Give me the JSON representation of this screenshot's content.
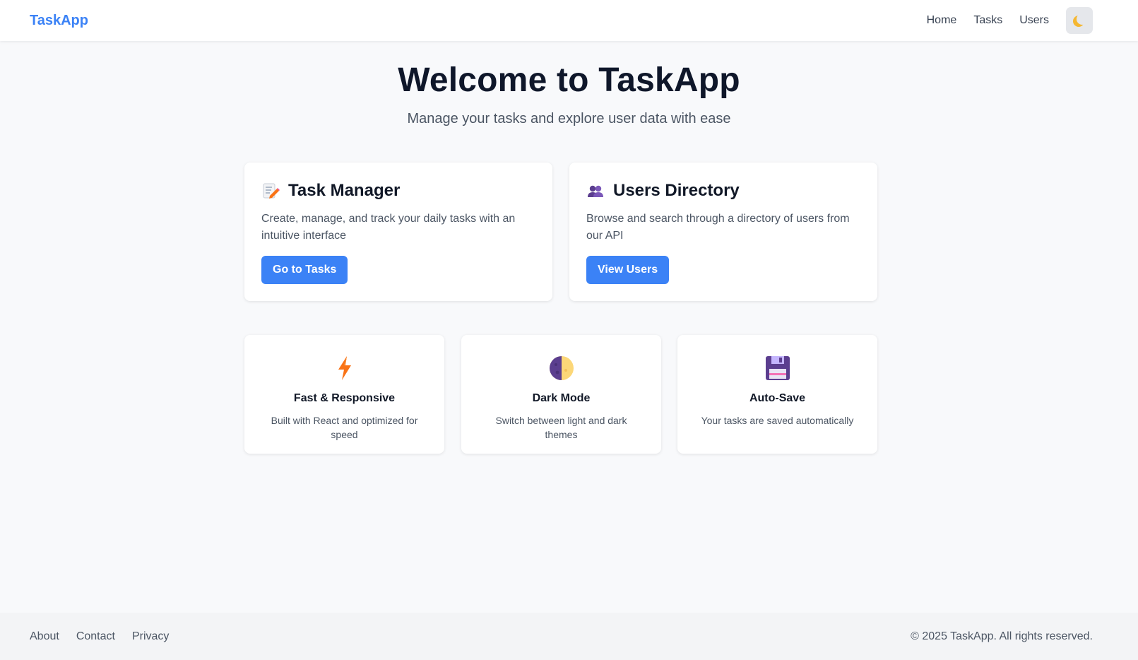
{
  "navbar": {
    "brand": "TaskApp",
    "links": [
      "Home",
      "Tasks",
      "Users"
    ],
    "theme_toggle_icon": "moon-icon"
  },
  "hero": {
    "title": "Welcome to TaskApp",
    "subtitle": "Manage your tasks and explore user data with ease"
  },
  "cards": [
    {
      "icon": "memo-icon",
      "title": "Task Manager",
      "description": "Create, manage, and track your daily tasks with an intuitive interface",
      "button": "Go to Tasks"
    },
    {
      "icon": "users-icon",
      "title": "Users Directory",
      "description": "Browse and search through a directory of users from our API",
      "button": "View Users"
    }
  ],
  "features": [
    {
      "icon": "lightning-icon",
      "title": "Fast & Responsive",
      "description": "Built with React and optimized for speed"
    },
    {
      "icon": "half-moon-icon",
      "title": "Dark Mode",
      "description": "Switch between light and dark themes"
    },
    {
      "icon": "floppy-disk-icon",
      "title": "Auto-Save",
      "description": "Your tasks are saved automatically"
    }
  ],
  "footer": {
    "links": [
      "About",
      "Contact",
      "Privacy"
    ],
    "copyright": "© 2025 TaskApp. All rights reserved."
  },
  "colors": {
    "accent": "#3b82f6",
    "background": "#f8f9fb",
    "heading": "#0f172a",
    "muted_text": "#4b5563"
  }
}
